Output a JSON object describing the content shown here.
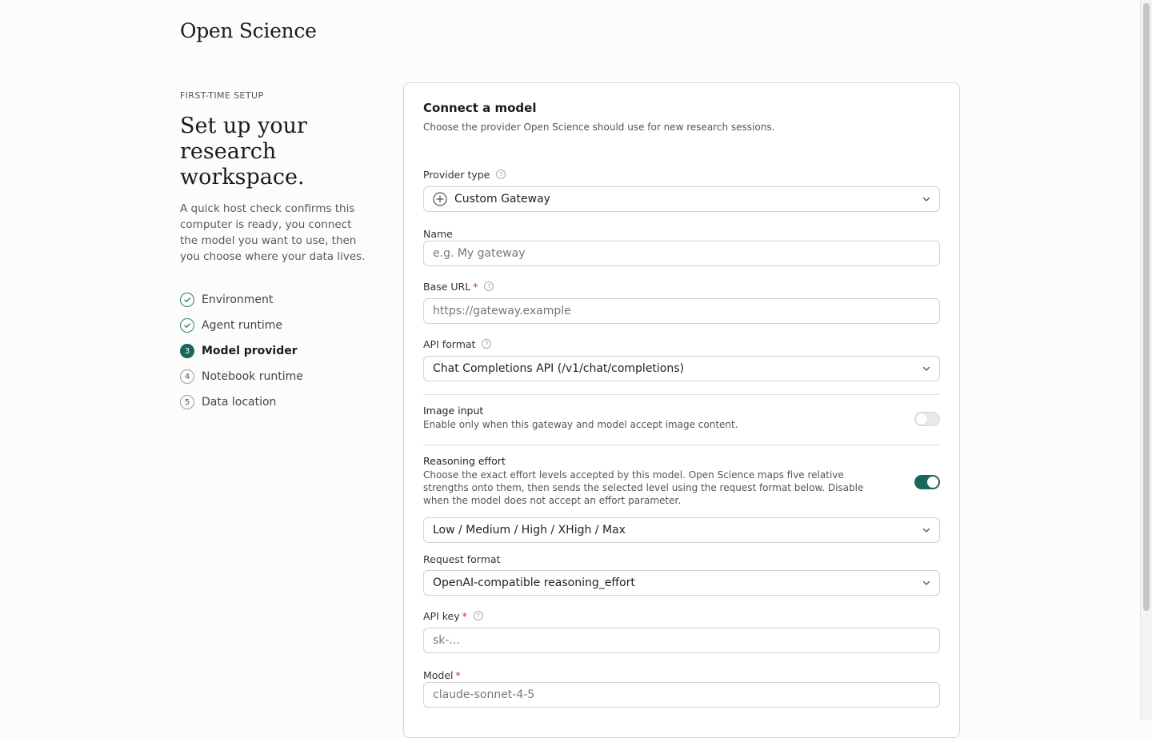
{
  "brand": "Open Science",
  "sidebar": {
    "eyebrow": "FIRST-TIME SETUP",
    "headline": "Set up your research workspace.",
    "intro": "A quick host check confirms this computer is ready, you connect the model you want to use, then you choose where your data lives.",
    "steps": [
      {
        "label": "Environment",
        "marker": "check",
        "state": "done"
      },
      {
        "label": "Agent runtime",
        "marker": "check",
        "state": "done"
      },
      {
        "label": "Model provider",
        "marker": "3",
        "state": "active"
      },
      {
        "label": "Notebook runtime",
        "marker": "4",
        "state": "pending"
      },
      {
        "label": "Data location",
        "marker": "5",
        "state": "pending"
      }
    ]
  },
  "card": {
    "title": "Connect a model",
    "subtitle": "Choose the provider Open Science should use for new research sessions.",
    "provider_type": {
      "label": "Provider type",
      "value": "Custom Gateway",
      "icon": "circle-plus-icon"
    },
    "name": {
      "label": "Name",
      "value": "",
      "placeholder": "e.g. My gateway"
    },
    "base_url": {
      "label": "Base URL",
      "value": "",
      "placeholder": "https://gateway.example"
    },
    "api_format": {
      "label": "API format",
      "value": "Chat Completions API (/v1/chat/completions)"
    },
    "image_input": {
      "title": "Image input",
      "description": "Enable only when this gateway and model accept image content.",
      "enabled": false
    },
    "reasoning_effort": {
      "title": "Reasoning effort",
      "description": "Choose the exact effort levels accepted by this model. Open Science maps five relative strengths onto them, then sends the selected level using the request format below. Disable when the model does not accept an effort parameter.",
      "enabled": true,
      "levels_value": "Low / Medium / High / XHigh / Max"
    },
    "request_format": {
      "label": "Request format",
      "value": "OpenAI-compatible reasoning_effort"
    },
    "api_key": {
      "label": "API key",
      "value": "",
      "placeholder": "sk-..."
    },
    "model": {
      "label": "Model",
      "value": "",
      "placeholder": "claude-sonnet-4-5"
    },
    "required_mark": "*",
    "help_glyph": "?"
  },
  "colors": {
    "accent": "#1a655c",
    "required": "#c0392b",
    "background": "#fcfcfa"
  }
}
